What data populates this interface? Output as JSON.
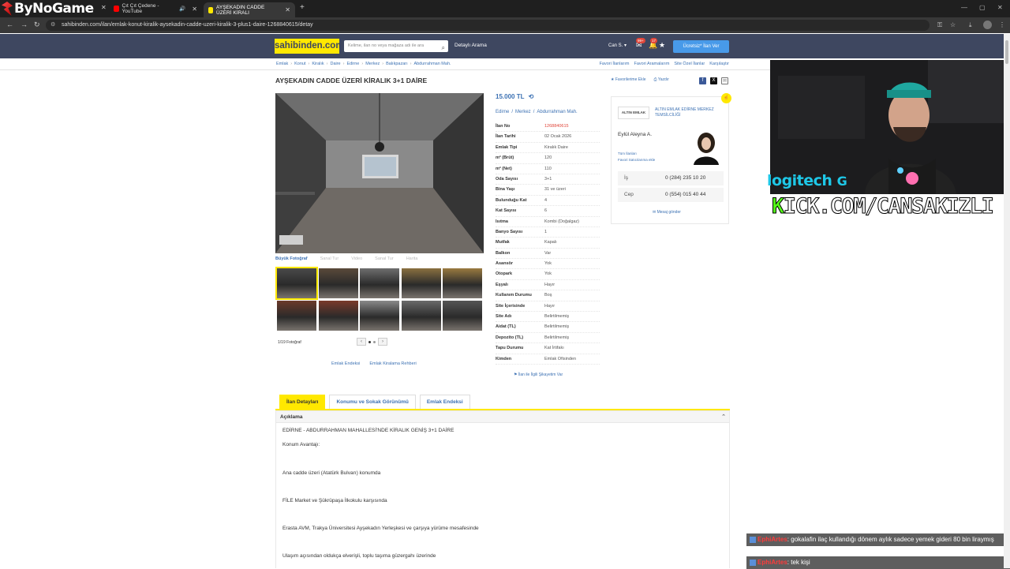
{
  "browser": {
    "brand": "ByNoGame",
    "tabs": [
      {
        "title": "Çıt Çıt Çedene - YouTube"
      },
      {
        "title": "AYŞEKADIN CADDE ÜZERİ KİRALI"
      }
    ],
    "url": "sahibinden.com/ilan/emlak-konut-kiralik-aysekadin-cadde-uzeri-kiralik-3-plus1-daire-1268840615/detay"
  },
  "site": {
    "logo": "sahibinden.com",
    "search_placeholder": "Kelime, ilan no veya mağaza adı ile ara",
    "detailed_search": "Detaylı Arama",
    "user": "Can S.",
    "badge_1": "99+",
    "badge_2": "17",
    "post_button": "Ücretsiz* İlan Ver",
    "breadcrumbs": [
      "Emlak",
      "Konut",
      "Kiralık",
      "Daire",
      "Edirne",
      "Merkez",
      "Balıkpazarı",
      "Abdurrahman Mah."
    ],
    "top_links": [
      "Favori İlanlarım",
      "Favori Aramalarım",
      "Site Özel İlanlar",
      "Karşılaştır"
    ]
  },
  "listing": {
    "title": "AYŞEKADIN CADDE ÜZERİ KİRALIK 3+1 DAİRE",
    "fav_action": "Favorilerime Ekle",
    "print_action": "Yazdır",
    "price": "15.000 TL",
    "location": [
      "Edirne",
      "/",
      "Merkez",
      "/",
      "Abdurrahman Mah."
    ],
    "photo_tools": [
      "Büyük Fotoğraf",
      "Sanal Tur",
      "Video",
      "Sanal Tur",
      "Harita"
    ],
    "photo_count": "1/19 Fotoğraf",
    "under_links": [
      "Emlak Endeksi",
      "Emlak Kiralama Rehberi"
    ],
    "complaint": "İlan ile İlgili Şikayetim Var",
    "info": [
      {
        "k": "İlan No",
        "v": "1268840615"
      },
      {
        "k": "İlan Tarihi",
        "v": "02 Ocak 2026"
      },
      {
        "k": "Emlak Tipi",
        "v": "Kiralık Daire"
      },
      {
        "k": "m² (Brüt)",
        "v": "120"
      },
      {
        "k": "m² (Net)",
        "v": "110"
      },
      {
        "k": "Oda Sayısı",
        "v": "3+1"
      },
      {
        "k": "Bina Yaşı",
        "v": "31 ve üzeri"
      },
      {
        "k": "Bulunduğu Kat",
        "v": "4"
      },
      {
        "k": "Kat Sayısı",
        "v": "6"
      },
      {
        "k": "Isıtma",
        "v": "Kombi (Doğalgaz)"
      },
      {
        "k": "Banyo Sayısı",
        "v": "1"
      },
      {
        "k": "Mutfak",
        "v": "Kapalı"
      },
      {
        "k": "Balkon",
        "v": "Var"
      },
      {
        "k": "Asansör",
        "v": "Yok"
      },
      {
        "k": "Otopark",
        "v": "Yok"
      },
      {
        "k": "Eşyalı",
        "v": "Hayır"
      },
      {
        "k": "Kullanım Durumu",
        "v": "Boş"
      },
      {
        "k": "Site İçerisinde",
        "v": "Hayır"
      },
      {
        "k": "Site Adı",
        "v": "Belirtilmemiş"
      },
      {
        "k": "Aidat (TL)",
        "v": "Belirtilmemiş"
      },
      {
        "k": "Depozito (TL)",
        "v": "Belirtilmemiş"
      },
      {
        "k": "Tapu Durumu",
        "v": "Kat İrtifakı"
      },
      {
        "k": "Kimden",
        "v": "Emlak Ofisinden"
      }
    ]
  },
  "agent": {
    "logo_text": "ALTIN EMLAK",
    "agency": "ALTIN EMLAK EDİRNE MERKEZ TEMSİLCİLİĞİ",
    "name": "Eylül Aleyna A.",
    "all_listings": "Tüm İlanları",
    "fav_seller": "Favori Satıcılarıma ekle",
    "phones": [
      {
        "label": "İş",
        "value": "0 (284) 235 10 20"
      },
      {
        "label": "Cep",
        "value": "0 (554) 015 40 44"
      }
    ],
    "message": "Mesaj gönder"
  },
  "detail_tabs": [
    "İlan Detayları",
    "Konumu ve Sokak Görünümü",
    "Emlak Endeksi"
  ],
  "description": {
    "heading": "Açıklama",
    "lines": [
      "EDİRNE - ABDURRAHMAN MAHALLESİ'NDE KİRALIK GENİŞ 3+1 DAİRE",
      "Konum Avantajı:",
      "Ana cadde üzeri (Atatürk Bulvarı) konumda",
      "FİLE Market ve Şükrüpaşa İlkokulu karşısında",
      "Erasta AVM, Trakya Üniversitesi Ayşekadın Yerleşkesi ve çarşıya yürüme mesafesinde",
      "Ulaşım açısından oldukça elverişli, toplu taşıma güzergahı üzerinde"
    ]
  },
  "overlay": {
    "logitech": "logitech",
    "kick_k": "K",
    "kick_rest": "ICK.COM/CANSAKIZLI",
    "chat": [
      {
        "user": "EphiArtes",
        "msg": ": gokalafin ilaç kullandığı dönem aylık sadece yemek gideri 80 bin liraymış"
      },
      {
        "user": "EphiArtes",
        "msg": ": tek kişi"
      }
    ]
  },
  "colors": {
    "brand_yellow": "#ffe800",
    "header_navy": "#3e4760",
    "link_blue": "#3c71b3",
    "kick_green": "#53fc18"
  }
}
